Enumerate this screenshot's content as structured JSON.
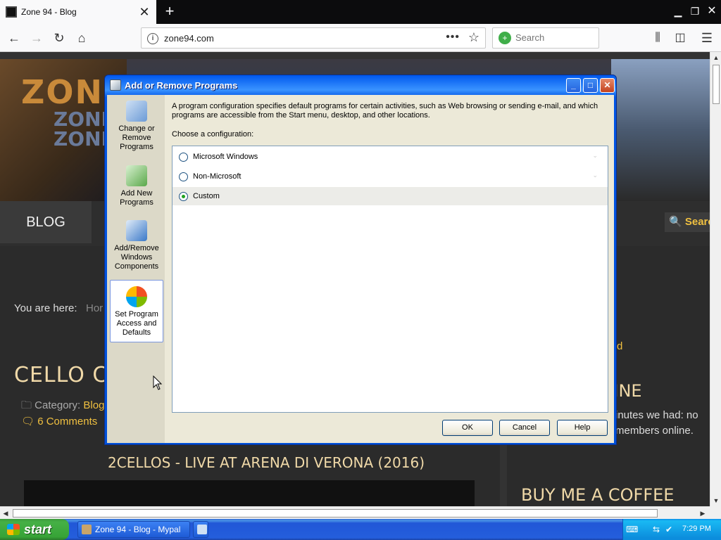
{
  "browser": {
    "tab_title": "Zone 94 - Blog",
    "url": "zone94.com",
    "search_placeholder": "Search"
  },
  "site": {
    "logo_text": "ZON",
    "logo_sub": "ZONE ZONE",
    "menu_blog": "BLOG",
    "search_label": "Searc",
    "breadcrumb_label": "You are here:",
    "breadcrumb_home": "Hor",
    "post_title": "CELLO CR",
    "category_label": "Category:",
    "category_link": "Blog",
    "comments": "6 Comments",
    "post_subtitle": "2CELLOS - LIVE AT ARENA DI VERONA (2016)",
    "sidebar_link": "d",
    "online_heading": "LINE",
    "online_text": "inutes we had: no members online.",
    "coffee_heading": "BUY ME A COFFEE"
  },
  "dialog": {
    "title": "Add or Remove Programs",
    "sidebar": [
      {
        "label": "Change or Remove Programs"
      },
      {
        "label": "Add New Programs"
      },
      {
        "label": "Add/Remove Windows Components"
      },
      {
        "label": "Set Program Access and Defaults"
      }
    ],
    "description": "A program configuration specifies default programs for certain activities, such as Web browsing or sending e-mail, and which programs are accessible from the Start menu, desktop, and other locations.",
    "choose_label": "Choose a configuration:",
    "configurations": [
      {
        "label": "Microsoft Windows",
        "selected": false
      },
      {
        "label": "Non-Microsoft",
        "selected": false
      },
      {
        "label": "Custom",
        "selected": true
      }
    ],
    "ok": "OK",
    "cancel": "Cancel",
    "help": "Help"
  },
  "taskbar": {
    "start": "start",
    "task_item": "Zone 94 - Blog - Mypal",
    "clock": "7:29 PM"
  }
}
